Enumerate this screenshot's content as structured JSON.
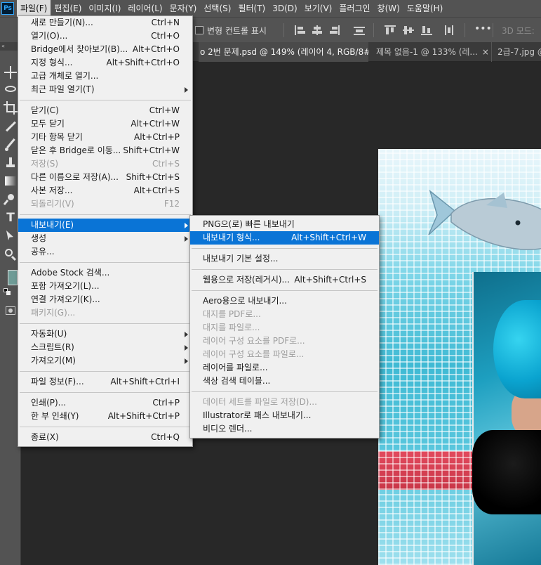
{
  "app_logo": "Ps",
  "menubar": {
    "items": [
      "파일(F)",
      "편집(E)",
      "이미지(I)",
      "레이어(L)",
      "문자(Y)",
      "선택(S)",
      "필터(T)",
      "3D(D)",
      "보기(V)",
      "플러그인",
      "창(W)",
      "도움말(H)"
    ],
    "active_index": 0
  },
  "options_bar": {
    "transform_controls_label": "변형 컨트롤 표시",
    "mode_3d_label": "3D 모드:",
    "more_label": "•••"
  },
  "tabs": [
    {
      "label": "o 2번 문제.psd @ 149% (레이어 4, RGB/8#)",
      "active": true,
      "close": "×"
    },
    {
      "label": "제목 없음-1 @ 133% (레...",
      "active": false,
      "close": "×"
    },
    {
      "label": "2급-7.jpg @",
      "active": false,
      "close": ""
    }
  ],
  "file_menu": {
    "items": [
      {
        "label": "새로 만들기(N)...",
        "shortcut": "Ctrl+N"
      },
      {
        "label": "열기(O)...",
        "shortcut": "Ctrl+O"
      },
      {
        "label": "Bridge에서 찾아보기(B)...",
        "shortcut": "Alt+Ctrl+O"
      },
      {
        "label": "지정 형식...",
        "shortcut": "Alt+Shift+Ctrl+O"
      },
      {
        "label": "고급 개체로 열기...",
        "shortcut": ""
      },
      {
        "label": "최근 파일 열기(T)",
        "shortcut": "",
        "submenu": true
      },
      {
        "separator": true
      },
      {
        "label": "닫기(C)",
        "shortcut": "Ctrl+W"
      },
      {
        "label": "모두 닫기",
        "shortcut": "Alt+Ctrl+W"
      },
      {
        "label": "기타 항목 닫기",
        "shortcut": "Alt+Ctrl+P"
      },
      {
        "label": "닫은 후 Bridge로 이동...",
        "shortcut": "Shift+Ctrl+W"
      },
      {
        "label": "저장(S)",
        "shortcut": "Ctrl+S",
        "disabled": true
      },
      {
        "label": "다른 이름으로 저장(A)...",
        "shortcut": "Shift+Ctrl+S"
      },
      {
        "label": "사본 저장...",
        "shortcut": "Alt+Ctrl+S"
      },
      {
        "label": "되돌리기(V)",
        "shortcut": "F12",
        "disabled": true
      },
      {
        "separator": true
      },
      {
        "label": "내보내기(E)",
        "shortcut": "",
        "submenu": true,
        "highlighted": true
      },
      {
        "label": "생성",
        "shortcut": "",
        "submenu": true
      },
      {
        "label": "공유...",
        "shortcut": ""
      },
      {
        "separator": true
      },
      {
        "label": "Adobe Stock 검색...",
        "shortcut": ""
      },
      {
        "label": "포함 가져오기(L)...",
        "shortcut": ""
      },
      {
        "label": "연결 가져오기(K)...",
        "shortcut": ""
      },
      {
        "label": "패키지(G)...",
        "shortcut": "",
        "disabled": true
      },
      {
        "separator": true
      },
      {
        "label": "자동화(U)",
        "shortcut": "",
        "submenu": true
      },
      {
        "label": "스크립트(R)",
        "shortcut": "",
        "submenu": true
      },
      {
        "label": "가져오기(M)",
        "shortcut": "",
        "submenu": true
      },
      {
        "separator": true
      },
      {
        "label": "파일 정보(F)...",
        "shortcut": "Alt+Shift+Ctrl+I"
      },
      {
        "separator": true
      },
      {
        "label": "인쇄(P)...",
        "shortcut": "Ctrl+P"
      },
      {
        "label": "한 부 인쇄(Y)",
        "shortcut": "Alt+Shift+Ctrl+P"
      },
      {
        "separator": true
      },
      {
        "label": "종료(X)",
        "shortcut": "Ctrl+Q"
      }
    ]
  },
  "export_menu": {
    "items": [
      {
        "label": "PNG으(로) 빠른 내보내기",
        "shortcut": ""
      },
      {
        "label": "내보내기 형식...",
        "shortcut": "Alt+Shift+Ctrl+W",
        "highlighted": true
      },
      {
        "separator": true
      },
      {
        "label": "내보내기 기본 설정...",
        "shortcut": ""
      },
      {
        "separator": true
      },
      {
        "label": "웹용으로 저장(레거시)...",
        "shortcut": "Alt+Shift+Ctrl+S"
      },
      {
        "separator": true
      },
      {
        "label": "Aero용으로 내보내기...",
        "shortcut": ""
      },
      {
        "label": "대지를 PDF로...",
        "shortcut": "",
        "disabled": true
      },
      {
        "label": "대지를 파일로...",
        "shortcut": "",
        "disabled": true
      },
      {
        "label": "레이어 구성 요소를 PDF로...",
        "shortcut": "",
        "disabled": true
      },
      {
        "label": "레이어 구성 요소를 파일로...",
        "shortcut": "",
        "disabled": true
      },
      {
        "label": "레이어를 파일로...",
        "shortcut": ""
      },
      {
        "label": "색상 검색 테이블...",
        "shortcut": ""
      },
      {
        "separator": true
      },
      {
        "label": "데이터 세트를 파일로 저장(D)...",
        "shortcut": "",
        "disabled": true
      },
      {
        "label": "Illustrator로 패스 내보내기...",
        "shortcut": ""
      },
      {
        "label": "비디오 렌더...",
        "shortcut": ""
      }
    ]
  },
  "colors": {
    "highlight": "#0a74d6",
    "foreground_swatch": "#6e9b96"
  }
}
